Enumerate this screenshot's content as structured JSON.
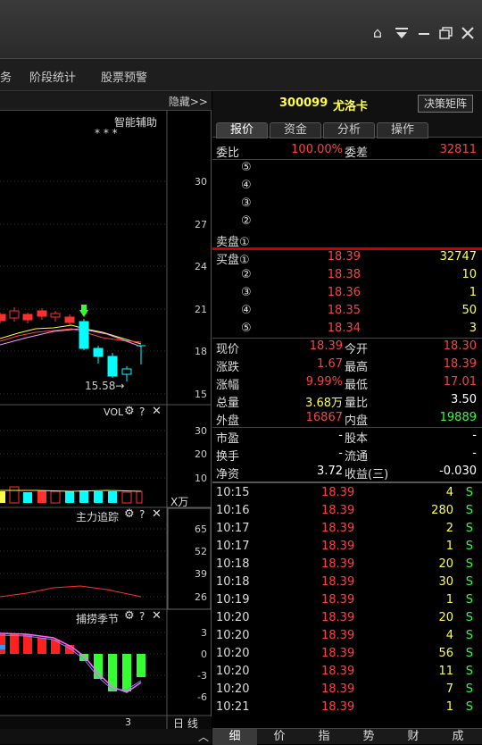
{
  "titlebar": {
    "icons": [
      "home-icon",
      "dropdown-icon",
      "minimize-icon",
      "restore-icon",
      "close-icon"
    ]
  },
  "menu": {
    "partial": "务",
    "items": [
      "阶段统计",
      "股票预警"
    ]
  },
  "chart": {
    "hide_label": "隐藏>>",
    "assist_label": "智能辅助",
    "stars": "* * *",
    "price_axis": [
      "30",
      "27",
      "24",
      "21",
      "18",
      "15"
    ],
    "low_marker": "15.58→",
    "vol_title": "VOL",
    "vol_axis": [
      "30",
      "20",
      "10"
    ],
    "vol_unit": "X万",
    "track_title": "主力追踪",
    "track_axis": [
      "65",
      "52",
      "39",
      "26"
    ],
    "season_title": "捕捞季节",
    "season_axis": [
      "3",
      "0",
      "-3",
      "-6"
    ],
    "bottom_num": "3",
    "period_label": "日 线",
    "scroll_label": "^"
  },
  "quote": {
    "code": "300099",
    "name": "尤洛卡",
    "decision_button": "决策矩阵",
    "tabs": [
      "报价",
      "资金",
      "分析",
      "操作"
    ],
    "ratio_label": "委比",
    "ratio_value": "100.00%",
    "diff_label": "委差",
    "diff_value": "32811",
    "sell_rows": [
      {
        "label": "⑤",
        "price": "",
        "vol": ""
      },
      {
        "label": "④",
        "price": "",
        "vol": ""
      },
      {
        "label": "③",
        "price": "",
        "vol": ""
      },
      {
        "label": "②",
        "price": "",
        "vol": ""
      },
      {
        "label": "卖盘①",
        "price": "",
        "vol": ""
      }
    ],
    "buy_rows": [
      {
        "label": "买盘①",
        "price": "18.39",
        "vol": "32747"
      },
      {
        "label": "②",
        "price": "18.38",
        "vol": "10"
      },
      {
        "label": "③",
        "price": "18.36",
        "vol": "1"
      },
      {
        "label": "④",
        "price": "18.35",
        "vol": "50"
      },
      {
        "label": "⑤",
        "price": "18.34",
        "vol": "3"
      }
    ],
    "stats": [
      {
        "l1": "现价",
        "v1": "18.39",
        "c1": "red",
        "l2": "今开",
        "v2": "18.30",
        "c2": "red"
      },
      {
        "l1": "涨跌",
        "v1": "1.67",
        "c1": "red",
        "l2": "最高",
        "v2": "18.39",
        "c2": "red"
      },
      {
        "l1": "涨幅",
        "v1": "9.99%",
        "c1": "red",
        "l2": "最低",
        "v2": "17.01",
        "c2": "red"
      },
      {
        "l1": "总量",
        "v1": "3.68万",
        "c1": "yellow",
        "l2": "量比",
        "v2": "3.50",
        "c2": "white"
      },
      {
        "l1": "外盘",
        "v1": "16867",
        "c1": "red",
        "l2": "内盘",
        "v2": "19889",
        "c2": "green"
      }
    ],
    "fund": [
      {
        "l1": "市盈",
        "v1": "-",
        "l2": "股本",
        "v2": "-"
      },
      {
        "l1": "换手",
        "v1": "-",
        "l2": "流通",
        "v2": "-"
      },
      {
        "l1": "净资",
        "v1": "3.72",
        "l2": "收益(三)",
        "v2": "-0.030"
      }
    ],
    "ticks": [
      {
        "time": "10:15",
        "price": "18.39",
        "vol": "4",
        "side": "S"
      },
      {
        "time": "10:16",
        "price": "18.39",
        "vol": "280",
        "side": "S"
      },
      {
        "time": "10:17",
        "price": "18.39",
        "vol": "2",
        "side": "S"
      },
      {
        "time": "10:17",
        "price": "18.39",
        "vol": "1",
        "side": "S"
      },
      {
        "time": "10:18",
        "price": "18.39",
        "vol": "20",
        "side": "S"
      },
      {
        "time": "10:18",
        "price": "18.39",
        "vol": "30",
        "side": "S"
      },
      {
        "time": "10:19",
        "price": "18.39",
        "vol": "1",
        "side": "S"
      },
      {
        "time": "10:20",
        "price": "18.39",
        "vol": "20",
        "side": "S"
      },
      {
        "time": "10:20",
        "price": "18.39",
        "vol": "4",
        "side": "S"
      },
      {
        "time": "10:20",
        "price": "18.39",
        "vol": "56",
        "side": "S"
      },
      {
        "time": "10:20",
        "price": "18.39",
        "vol": "11",
        "side": "S"
      },
      {
        "time": "10:20",
        "price": "18.39",
        "vol": "7",
        "side": "S"
      },
      {
        "time": "10:21",
        "price": "18.39",
        "vol": "1",
        "side": "S"
      }
    ],
    "bottom_tabs": [
      "细",
      "价",
      "指",
      "势",
      "财",
      "成"
    ]
  }
}
